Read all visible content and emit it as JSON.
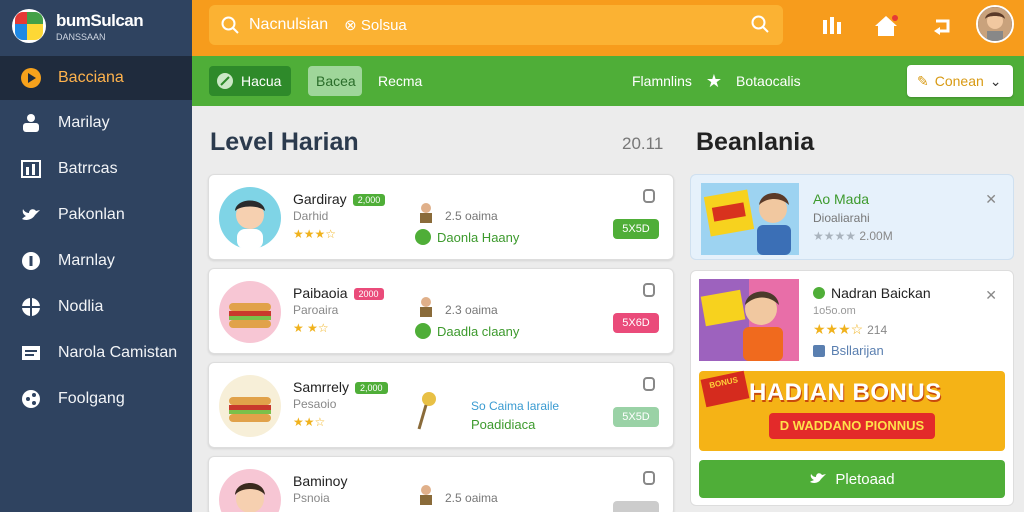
{
  "brand": {
    "title": "bumSulcan",
    "subtitle": "DANSSAAN"
  },
  "sidebar": {
    "items": [
      {
        "label": "Bacciana",
        "icon": "play-circle-icon",
        "active": true
      },
      {
        "label": "Marilay",
        "icon": "user-group-icon"
      },
      {
        "label": "Batrrcas",
        "icon": "chart-icon"
      },
      {
        "label": "Pakonlan",
        "icon": "bird-icon"
      },
      {
        "label": "Marnlay",
        "icon": "info-circle-icon"
      },
      {
        "label": "Nodlia",
        "icon": "globe-icon"
      },
      {
        "label": "Narola Camistan",
        "icon": "list-icon"
      },
      {
        "label": "Foolgang",
        "icon": "share-icon"
      }
    ]
  },
  "topbar": {
    "search_placeholder": "Nacnulsian",
    "search_filter": "Solsua"
  },
  "greenbar": {
    "tabs": [
      "Hacua",
      "Bacea",
      "Recma"
    ],
    "right_links": [
      "Flamnlins",
      "Botaocalis"
    ],
    "action_label": "Conean"
  },
  "main": {
    "title": "Level Harian",
    "meta": "20.11",
    "cards": [
      {
        "name": "Gardiray",
        "tag": "2,000",
        "sub": "Darhid",
        "stars": "★★★☆",
        "meta1": "2.5 oaima",
        "meta2": "Daonla Haany",
        "badge": "5X5D",
        "badge_color": "#4fae38",
        "tag_color": "#4fae38"
      },
      {
        "name": "Paibaoia",
        "tag": "2000",
        "sub": "Paroaira",
        "stars": "★ ★☆",
        "meta1": "2.3 oaima",
        "meta2": "Daadla claany",
        "badge": "5X6D",
        "badge_color": "#ea4b7a",
        "tag_color": "#ea4b7a"
      },
      {
        "name": "Samrrely",
        "tag": "2,000",
        "sub": "Pesaoio",
        "stars": "★★☆",
        "meta1": "So Caima laraile",
        "meta2": "Poadidiaca",
        "badge": "5X5D",
        "badge_color": "#9ad2a6",
        "tag_color": "#4fae38"
      },
      {
        "name": "Baminoy",
        "tag": "",
        "sub": "Psnoia",
        "stars": "",
        "meta1": "2.5 oaima",
        "meta2": "",
        "badge": "",
        "badge_color": "#cccccc",
        "tag_color": "#4fae38"
      }
    ]
  },
  "right": {
    "title": "Beanlania",
    "card1": {
      "title": "Ao Mada",
      "sub": "Dioaliarahi",
      "stars": "★★★★",
      "count": "2.00M"
    },
    "card2": {
      "title": "Nadran Baickan",
      "sub": "1o5o.om",
      "stars": "★★★☆",
      "count": "214",
      "check_label": "Bsllarijan"
    },
    "bonus": {
      "text": "HADIAN BONUS",
      "pill": "D WADDANO PIONNUS",
      "stamp": "BONUS"
    },
    "button": "Pletoaad"
  },
  "colors": {
    "sidebar": "#2f4360",
    "topbar": "#f79c1c",
    "green": "#4fae38"
  }
}
